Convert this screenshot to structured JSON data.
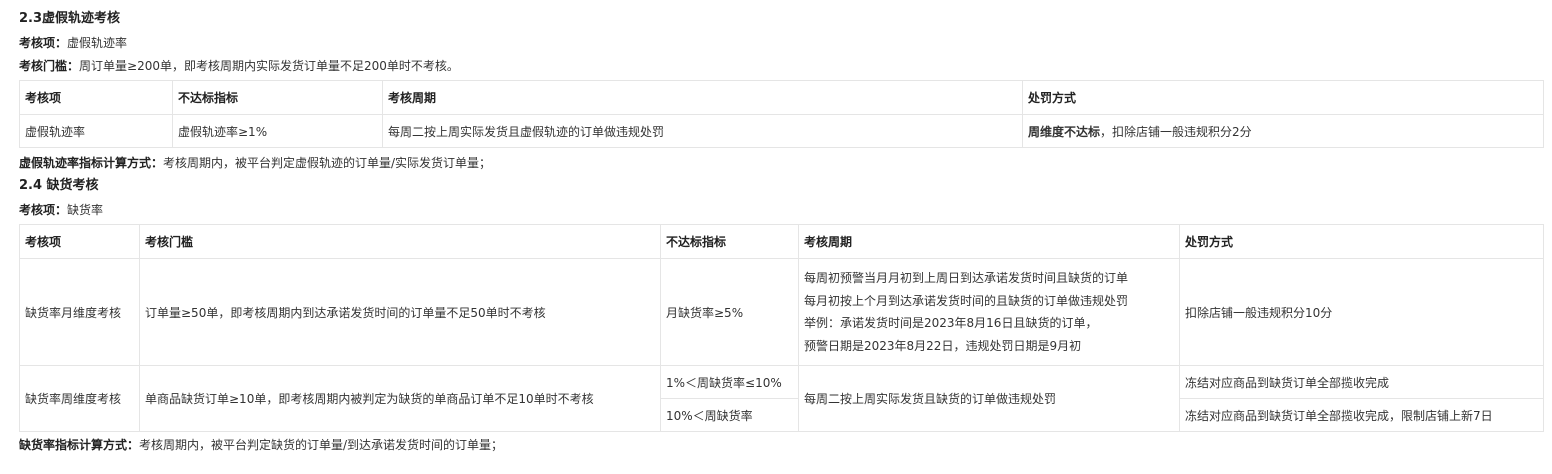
{
  "section_23": {
    "title": "2.3虚假轨迹考核",
    "item_label": "考核项：",
    "item_value": "虚假轨迹率",
    "threshold_label": "考核门槛：",
    "threshold_value": "周订单量≥200单，即考核周期内实际发货订单量不足200单时不考核。",
    "table": {
      "headers": [
        "考核项",
        "不达标指标",
        "考核周期",
        "处罚方式"
      ],
      "row": {
        "item": "虚假轨迹率",
        "indicator": "虚假轨迹率≥1%",
        "cycle": "每周二按上周实际发货且虚假轨迹的订单做违规处罚",
        "penalty_bold": "周维度不达标",
        "penalty_rest": "，扣除店铺一般违规积分2分"
      }
    },
    "calc_label": "虚假轨迹率指标计算方式：",
    "calc_value": "考核周期内，被平台判定虚假轨迹的订单量/实际发货订单量；"
  },
  "section_24": {
    "title": "2.4 缺货考核",
    "item_label": "考核项：",
    "item_value": "缺货率",
    "table": {
      "headers": [
        "考核项",
        "考核门槛",
        "不达标指标",
        "考核周期",
        "处罚方式"
      ],
      "row_month": {
        "item": "缺货率月维度考核",
        "threshold": "订单量≥50单，即考核周期内到达承诺发货时间的订单量不足50单时不考核",
        "indicator": "月缺货率≥5%",
        "cycle_lines": [
          "每周初预警当月月初到上周日到达承诺发货时间且缺货的订单",
          "每月初按上个月到达承诺发货时间的且缺货的订单做违规处罚",
          "举例：承诺发货时间是2023年8月16日且缺货的订单，",
          "预警日期是2023年8月22日，违规处罚日期是9月初"
        ],
        "penalty": "扣除店铺一般违规积分10分"
      },
      "row_week": {
        "item": "缺货率周维度考核",
        "threshold": "单商品缺货订单≥10单，即考核周期内被判定为缺货的单商品订单不足10单时不考核",
        "indicator_1": "1%＜周缺货率≤10%",
        "indicator_2": "10%＜周缺货率",
        "cycle": "每周二按上周实际发货且缺货的订单做违规处罚",
        "penalty_1": "冻结对应商品到缺货订单全部揽收完成",
        "penalty_2": "冻结对应商品到缺货订单全部揽收完成，限制店铺上新7日"
      }
    },
    "calc_label": "缺货率指标计算方式：",
    "calc_value": "考核周期内，被平台判定缺货的订单量/到达承诺发货时间的订单量；"
  }
}
